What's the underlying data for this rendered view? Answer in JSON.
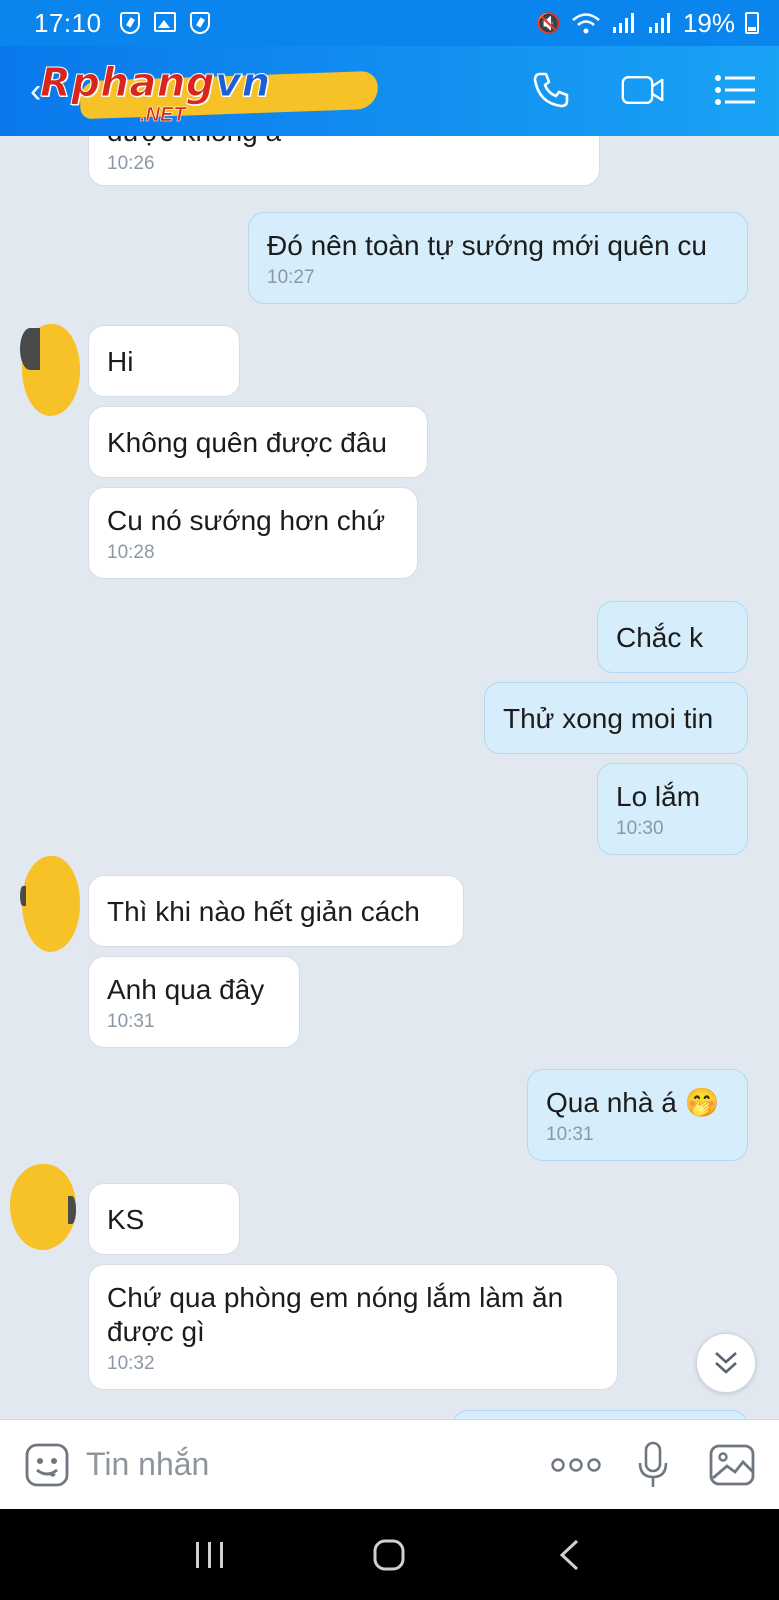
{
  "status_bar": {
    "time": "17:10",
    "battery": "19%"
  },
  "header": {
    "logo_text_1": "Rphang",
    "logo_text_2": "vn",
    "logo_sub": ".NET",
    "icons": [
      "phone-icon",
      "video-camera-icon",
      "menu-list-icon"
    ]
  },
  "messages": [
    {
      "side": "in",
      "text": "được không á",
      "time": "10:26"
    },
    {
      "side": "out",
      "text": "Đó nên toàn tự sướng mới quên cu",
      "time": "10:27"
    },
    {
      "side": "in",
      "text": "Hi",
      "time": ""
    },
    {
      "side": "in",
      "text": "Không quên được đâu",
      "time": ""
    },
    {
      "side": "in",
      "text": "Cu nó sướng hơn chứ",
      "time": "10:28"
    },
    {
      "side": "out",
      "text": "Chắc k",
      "time": ""
    },
    {
      "side": "out",
      "text": "Thử xong moi tin",
      "time": ""
    },
    {
      "side": "out",
      "text": "Lo lắm",
      "time": "10:30"
    },
    {
      "side": "in",
      "text": "Thì khi nào hết giản cách",
      "time": ""
    },
    {
      "side": "in",
      "text": "Anh qua đây",
      "time": "10:31"
    },
    {
      "side": "out",
      "text": "Qua nhà á 🤭",
      "time": "10:31"
    },
    {
      "side": "in",
      "text": "KS",
      "time": ""
    },
    {
      "side": "in",
      "text": "Chứ qua phòng em nóng lắm làm ăn được gì",
      "time": "10:32"
    }
  ],
  "input": {
    "placeholder": "Tin nhắn",
    "icons": [
      "sticker-icon",
      "more-icon",
      "microphone-icon",
      "image-icon"
    ]
  },
  "colors": {
    "header": "#0a85ee",
    "outgoing_bubble": "#d6edfb",
    "incoming_bubble": "#ffffff",
    "chat_bg": "#e2e8f0"
  }
}
